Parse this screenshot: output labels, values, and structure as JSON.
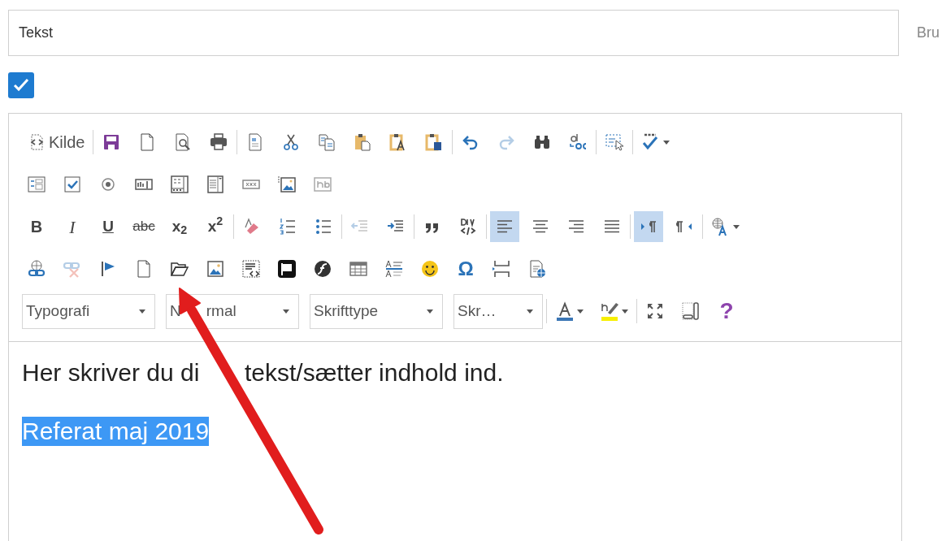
{
  "title_field": {
    "value": "Tekst"
  },
  "side_label": "Bru",
  "published": {
    "checked": true
  },
  "editor": {
    "toolbar": [
      {
        "groups": [
          [
            {
              "kind": "source",
              "label": "Kilde",
              "on": false,
              "disabled": false
            }
          ],
          [
            {
              "kind": "save",
              "on": false,
              "disabled": false
            },
            {
              "kind": "newpage",
              "on": false,
              "disabled": false
            },
            {
              "kind": "preview",
              "on": false,
              "disabled": false
            },
            {
              "kind": "print",
              "on": false,
              "disabled": false
            }
          ],
          [
            {
              "kind": "templates",
              "on": false,
              "disabled": false
            },
            {
              "kind": "cut",
              "on": false,
              "disabled": false
            },
            {
              "kind": "copy",
              "on": false,
              "disabled": false
            },
            {
              "kind": "paste",
              "on": false,
              "disabled": false
            },
            {
              "kind": "pastetext",
              "on": false,
              "disabled": false
            },
            {
              "kind": "pasteword",
              "on": false,
              "disabled": false
            }
          ],
          [
            {
              "kind": "undo",
              "on": false,
              "disabled": false
            },
            {
              "kind": "redo",
              "on": false,
              "disabled": true
            },
            {
              "kind": "find",
              "on": false,
              "disabled": false
            },
            {
              "kind": "replace",
              "on": false,
              "disabled": false
            }
          ],
          [
            {
              "kind": "selectall",
              "on": false,
              "disabled": false
            }
          ],
          [
            {
              "kind": "scayt"
            }
          ]
        ]
      },
      {
        "groups": [
          [
            {
              "kind": "form"
            },
            {
              "kind": "checkbox"
            },
            {
              "kind": "radio"
            },
            {
              "kind": "textfield"
            },
            {
              "kind": "textarea"
            },
            {
              "kind": "select"
            },
            {
              "kind": "formbutton"
            },
            {
              "kind": "imagebutton"
            },
            {
              "kind": "hiddenfield"
            }
          ]
        ]
      },
      {
        "groups": [
          [
            {
              "kind": "bold",
              "glyph": "B",
              "on": false,
              "disabled": false
            },
            {
              "kind": "italic",
              "glyph": "I",
              "on": false,
              "disabled": false
            },
            {
              "kind": "underline",
              "glyph": "U",
              "on": false,
              "disabled": false
            },
            {
              "kind": "strike",
              "glyph": "abc",
              "on": false,
              "disabled": false
            },
            {
              "kind": "subscript",
              "glyph": "x$_{2}$",
              "on": false,
              "disabled": false
            },
            {
              "kind": "superscript",
              "glyph": "x$^{2}$",
              "on": false,
              "disabled": false
            }
          ],
          [
            {
              "kind": "removeformat",
              "on": false,
              "disabled": false
            },
            {
              "kind": "numberedlist",
              "on": false,
              "disabled": false
            },
            {
              "kind": "bulletedlist",
              "on": false,
              "disabled": false
            }
          ],
          [
            {
              "kind": "outdent",
              "on": false,
              "disabled": true
            },
            {
              "kind": "indent",
              "on": false,
              "disabled": false
            }
          ],
          [
            {
              "kind": "blockquote",
              "on": false,
              "disabled": false
            },
            {
              "kind": "creatediv",
              "on": false,
              "disabled": false
            }
          ],
          [
            {
              "kind": "alignleft",
              "on": true,
              "disabled": false
            },
            {
              "kind": "aligncenter",
              "on": false,
              "disabled": false
            },
            {
              "kind": "alignright",
              "on": false,
              "disabled": false
            },
            {
              "kind": "alignjustify",
              "on": false,
              "disabled": false
            }
          ],
          [
            {
              "kind": "bidiltr",
              "on": true,
              "disabled": false
            },
            {
              "kind": "bidirtl",
              "on": false,
              "disabled": false
            }
          ],
          [
            {
              "kind": "language",
              "disabled": false
            }
          ]
        ]
      },
      {
        "groups": [
          [
            {
              "kind": "link",
              "on": false,
              "disabled": false
            },
            {
              "kind": "unlink",
              "on": false,
              "disabled": true
            },
            {
              "kind": "anchor",
              "on": false,
              "disabled": false
            },
            {
              "kind": "newpage",
              "on": false,
              "disabled": false
            },
            {
              "kind": "openfile",
              "on": false,
              "disabled": false
            },
            {
              "kind": "image",
              "on": false,
              "disabled": false
            },
            {
              "kind": "iframe",
              "on": false,
              "disabled": false
            },
            {
              "kind": "flagtile",
              "on": false,
              "disabled": false
            },
            {
              "kind": "flash",
              "on": false,
              "disabled": false
            },
            {
              "kind": "table",
              "on": false,
              "disabled": false
            },
            {
              "kind": "styles",
              "on": false,
              "disabled": false
            },
            {
              "kind": "smiley",
              "on": false,
              "disabled": false
            },
            {
              "kind": "specialchar",
              "glyph": "Ω",
              "on": false,
              "disabled": false
            },
            {
              "kind": "pagebreak",
              "on": false,
              "disabled": false
            },
            {
              "kind": "pageglobe",
              "on": false,
              "disabled": false
            }
          ]
        ]
      },
      {
        "groups": [
          [
            {
              "kind": "combo",
              "value": "Typografi",
              "on": false,
              "disabled": false
            },
            {
              "kind": "combo",
              "value": "N",
              "value_2": "rmal",
              "on": false,
              "disabled": false
            },
            {
              "kind": "combo",
              "value": "Skrifttype",
              "on": false,
              "disabled": false
            },
            {
              "kind": "combo",
              "value": "Skr…",
              "on": false,
              "disabled": false
            }
          ],
          [
            {
              "kind": "textcolor",
              "on": false,
              "disabled": false
            },
            {
              "kind": "bgcolor",
              "on": false,
              "disabled": false
            }
          ],
          [
            {
              "kind": "maximize",
              "on": false,
              "disabled": false
            },
            {
              "kind": "showblocks",
              "on": false,
              "disabled": false
            },
            {
              "kind": "about",
              "glyph": "?",
              "on": false,
              "disabled": false
            }
          ]
        ]
      }
    ],
    "content": [
      {
        "text": "Her skriver du di",
        "text_2": "tekst/sætter indhold ind.",
        "selected": false
      },
      {
        "text": "Referat maj 2019",
        "selected": true
      }
    ]
  }
}
